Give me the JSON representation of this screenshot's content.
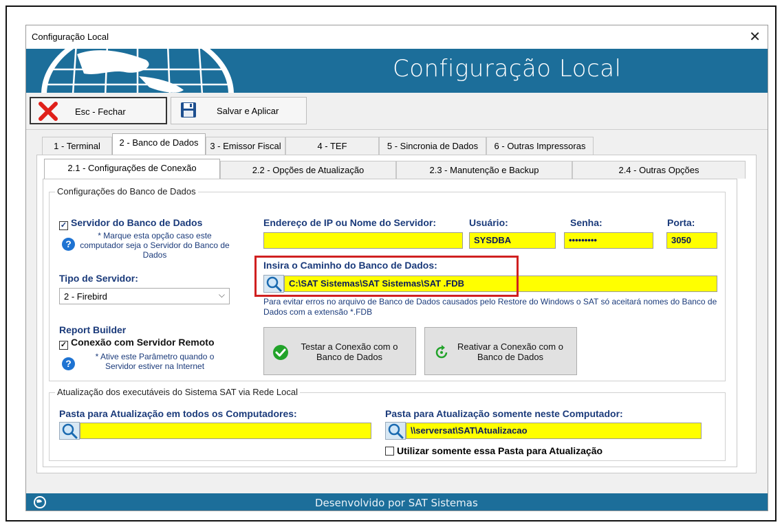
{
  "window": {
    "title": "Configuração Local",
    "close_glyph": "✕",
    "banner_title": "Configuração Local",
    "footer": "Desenvolvido por SAT Sistemas"
  },
  "toolbar": {
    "close_label": "Esc - Fechar",
    "save_label": "Salvar e Aplicar"
  },
  "tabs": [
    "1 - Terminal",
    "2 - Banco de Dados",
    "3 - Emissor Fiscal",
    "4 - TEF",
    "5 - Sincronia de Dados",
    "6 - Outras Impressoras"
  ],
  "active_tab": "2 - Banco de Dados",
  "subtabs": [
    "2.1 - Configurações de Conexão",
    "2.2 - Opções de Atualização",
    "2.3 - Manutenção e Backup",
    "2.4 - Outras Opções"
  ],
  "db_group": {
    "legend": "Configurações do Banco de Dados",
    "server_checkbox_label": "Servidor do Banco de Dados",
    "server_checked": true,
    "server_hint": "* Marque esta opção caso este computador seja o Servidor do Banco de Dados",
    "server_type_label": "Tipo de Servidor:",
    "server_type_value": "2 - Firebird",
    "report_builder_label": "Report Builder",
    "remote_checkbox_label": "Conexão com Servidor Remoto",
    "remote_checked": true,
    "remote_hint": "* Ative este Parâmetro quando o Servidor estiver na Internet",
    "ip_label": "Endereço de IP ou Nome do Servidor:",
    "ip_value": "",
    "user_label": "Usuário:",
    "user_value": "SYSDBA",
    "password_label": "Senha:",
    "password_value": "•••••••••",
    "port_label": "Porta:",
    "port_value": "3050",
    "path_label": "Insira o Caminho do Banco de Dados:",
    "path_value": "C:\\SAT Sistemas\\SAT Sistemas\\SAT .FDB",
    "path_note": "Para evitar erros no arquivo de Banco de Dados causados pelo Restore do Windows o SAT só aceitará nomes do Banco de Dados com a extensão *.FDB",
    "test_button": "Testar a Conexão com o Banco de Dados",
    "reactivate_button": "Reativar a Conexão com o Banco de Dados"
  },
  "update_group": {
    "legend": "Atualização dos executáveis do Sistema SAT via Rede Local",
    "all_label": "Pasta para Atualização em todos os Computadores:",
    "all_value": "",
    "local_label": "Pasta para Atualização somente neste Computador:",
    "local_value": "\\\\serversat\\SAT\\Atualizacao",
    "only_checkbox_label": "Utilizar somente essa Pasta para Atualização",
    "only_checked": false
  },
  "colors": {
    "brand_blue": "#1c6e9a",
    "field_yellow": "#ffff00",
    "highlight_red": "#d02020"
  }
}
